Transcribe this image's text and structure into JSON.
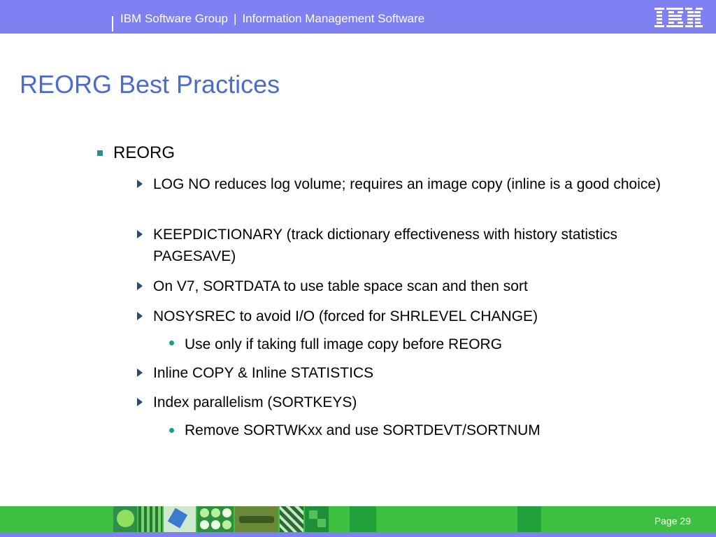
{
  "header": {
    "group": "IBM Software Group",
    "separator": "|",
    "division": "Information Management Software",
    "logo_text": "IBM"
  },
  "title": "REORG Best Practices",
  "bullets": {
    "l1": "REORG",
    "items": [
      "LOG NO reduces log volume; requires an image copy (inline is a good choice)",
      "KEEPDICTIONARY (track dictionary effectiveness with history statistics PAGESAVE)",
      "On V7, SORTDATA to use table space scan and then sort",
      "NOSYSREC to avoid I/O (forced for SHRLEVEL CHANGE)",
      "Inline COPY & Inline STATISTICS",
      "Index parallelism (SORTKEYS)"
    ],
    "sub_nosysrec": "Use only if taking full image copy before REORG",
    "sub_parallel": "Remove SORTWKxx and use SORTDEVT/SORTNUM"
  },
  "footer": {
    "page": "Page 29"
  },
  "colors": {
    "header_bg": "#7f80f2",
    "title": "#4c6ccc",
    "footer_bg": "#3fbf3f"
  }
}
